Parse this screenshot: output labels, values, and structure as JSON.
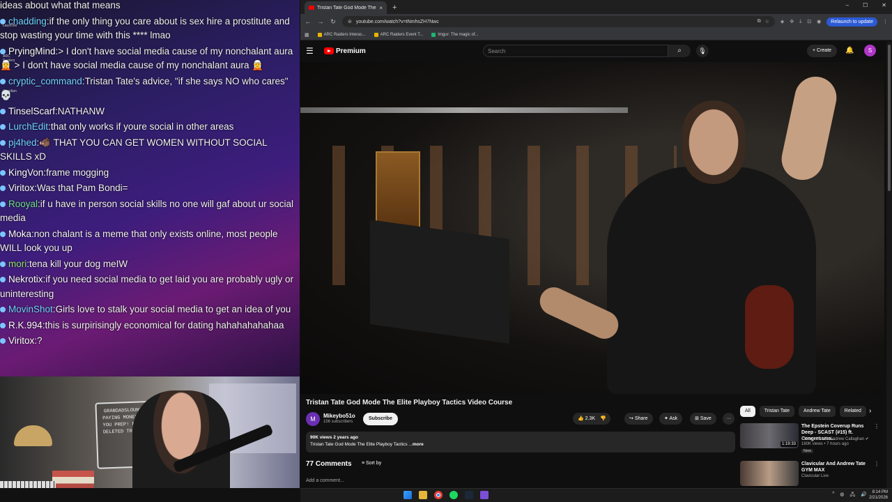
{
  "chat": {
    "messages": [
      {
        "user": "",
        "sep": "",
        "text": "ideas about what that means",
        "color": "#ffffff"
      },
      {
        "user": "chadding",
        "sep": ":",
        "text": "if the only thing you care about is sex hire a prostitute and stop wasting your time with this **** lmao",
        "color": "#6fd3ff"
      },
      {
        "user": "PryingMind",
        "sep": ":",
        "text": "> I don't have social media cause of my nonchalant aura 🧝 > I don't have social media cause of my nonchalant aura 🧝",
        "color": "#ffffff"
      },
      {
        "user": "cryptic_command",
        "sep": ":",
        "text": "Tristan Tate's advice, \"if she says NO who cares\" 💀",
        "color": "#6fd3ff"
      },
      {
        "user": "TinselScarf",
        "sep": ":",
        "text": "NATHANW",
        "color": "#ffffff"
      },
      {
        "user": "LurchEdit",
        "sep": ":",
        "text": "that only works if youre social in other areas",
        "color": "#6fd3ff"
      },
      {
        "user": "pj4hed",
        "sep": ":",
        "text": "🐗 THAT YOU CAN GET WOMEN WITHOUT SOCIAL SKILLS xD",
        "color": "#6fd3ff"
      },
      {
        "user": "KingVon",
        "sep": ":",
        "text": "frame mogging",
        "color": "#ffffff"
      },
      {
        "user": "Viritox",
        "sep": ":",
        "text": "Was that Pam Bondi=",
        "color": "#ffffff"
      },
      {
        "user": "Rooyal",
        "sep": ":",
        "text": "if u have in person social skills no one will gaf about ur social media",
        "color": "#6fe28a"
      },
      {
        "user": "Moka",
        "sep": ":",
        "text": "non chalant is a meme that only exists online, most people WILL look you up",
        "color": "#ffffff"
      },
      {
        "user": "mori",
        "sep": ":",
        "text": "tena kill your dog meIW",
        "color": "#8fe36a"
      },
      {
        "user": "Nekrotix",
        "sep": ":",
        "text": "if you need social media to get laid you are probably ugly or uninteresting",
        "color": "#ffffff"
      },
      {
        "user": "MovinShot",
        "sep": ":",
        "text": "Girls love to stalk your social media to get an idea of you",
        "color": "#6fd3ff"
      },
      {
        "user": "R.K.994",
        "sep": ":",
        "text": "this is surpirisingly economical for dating hahahahahahaa",
        "color": "#ffffff"
      },
      {
        "user": "Viritox",
        "sep": ":",
        "text": "?",
        "color": "#ffffff"
      }
    ],
    "side_icons": [
      "Launcher",
      "ARC Raiders",
      "Obsidian"
    ]
  },
  "webcam": {
    "sign_text": "GRANDADSLOUNGE ... PAYING MONEY TO ... YOU PREP! NEVER ... DELETED TRIGGER ..."
  },
  "browser": {
    "tab_title": "Tristan Tate God Mode The Elite",
    "tab_close": "×",
    "new_tab": "+",
    "win_controls": [
      "–",
      "☐",
      "✕"
    ],
    "url": "youtube.com/watch?v=tNmhsZH7Nwc",
    "relaunch": "Relaunch to update",
    "bookmarks": [
      "ARC Raiders Interac...",
      "ARC Raiders Event T...",
      "Imgur: The magic of..."
    ]
  },
  "youtube": {
    "logo_text": "Premium",
    "search_placeholder": "Search",
    "create_label": "+ Create",
    "avatar_letter": "S",
    "video_title": "Tristan Tate God Mode The Elite Playboy Tactics Video Course",
    "channel_name": "Mikeybo51o",
    "channel_subs": "156 subscribers",
    "channel_avatar_letter": "M",
    "subscribe_label": "Subscribe",
    "like_count": "2.3K",
    "share_label": "Share",
    "ask_label": "Ask",
    "save_label": "Save",
    "more_label": "···",
    "desc_meta": "90K views  2 years ago",
    "desc_text": "Tristan Tate   God Mode The Elite Playboy Tactics ...",
    "desc_more": "more",
    "comments_count": "77 Comments",
    "sort_label": "Sort by",
    "add_comment": "Add a comment...",
    "chips": [
      "All",
      "Tristan Tate",
      "Andrew Tate",
      "Related"
    ],
    "recommendations": [
      {
        "title": "The Epstein Coverup Runs Deep - SCAST (#15) ft. Congressma...",
        "channel": "Channel 5 with Andrew Callaghan ✔",
        "meta": "160K views • 7 hours ago",
        "badge": "New",
        "duration": "1:19:33"
      },
      {
        "title": "Clavicular And Andrew Tate GYM MAX",
        "channel": "Clavicular Live",
        "meta": "",
        "badge": "",
        "duration": ""
      }
    ]
  },
  "taskbar": {
    "time": "8:14 PM",
    "date": "2/21/2026"
  }
}
